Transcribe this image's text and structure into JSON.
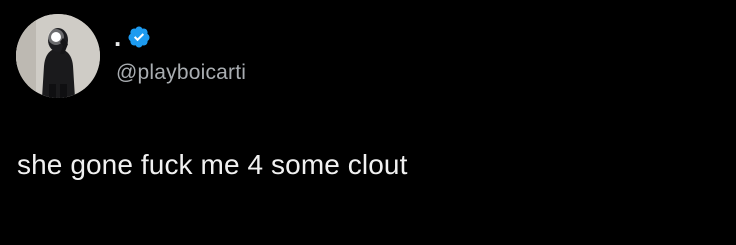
{
  "tweet": {
    "display_name": ".",
    "handle": "@playboicarti",
    "text": "she gone fuck me 4 some clout",
    "verified_icon": "verified-badge-icon",
    "avatar_icon": "profile-avatar"
  },
  "colors": {
    "background": "#000000",
    "text": "#e7e9ea",
    "handle": "#a9adb1",
    "verified": "#1d9bf0"
  }
}
